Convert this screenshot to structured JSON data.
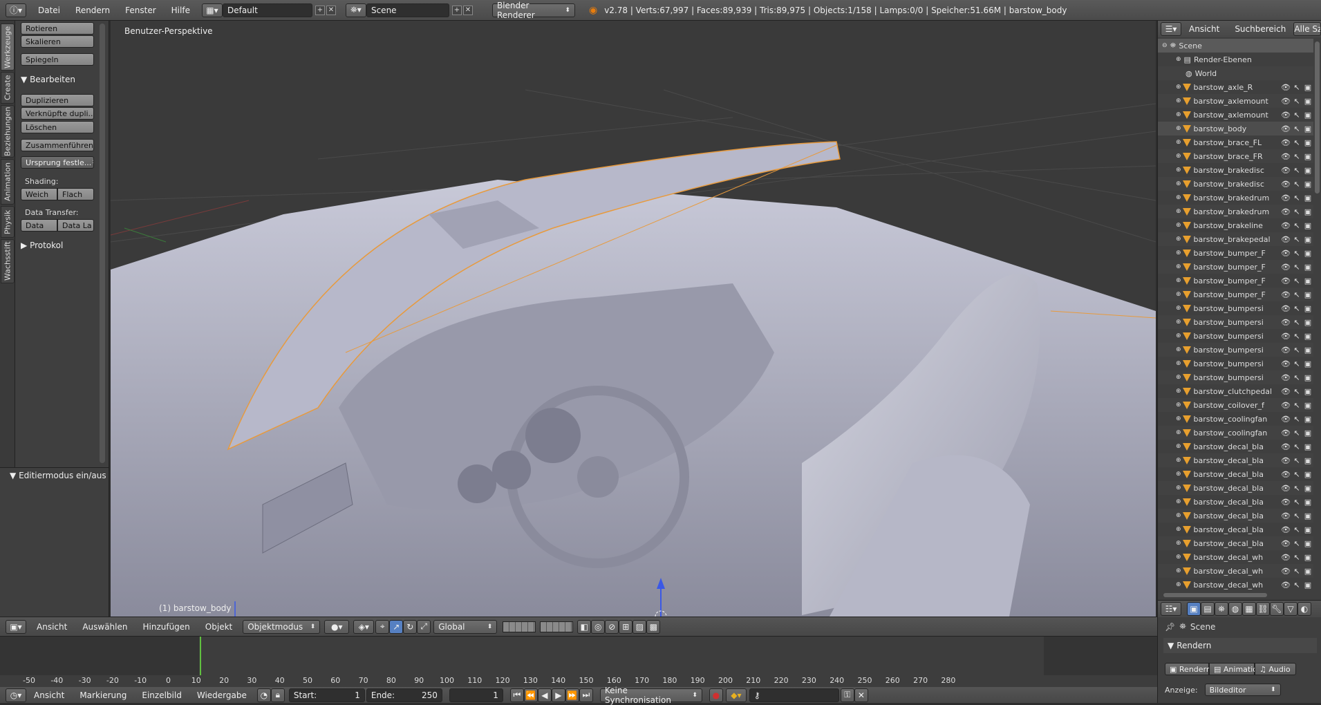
{
  "topbar": {
    "menus": [
      "Datei",
      "Rendern",
      "Fenster",
      "Hilfe"
    ],
    "screen_layout": "Default",
    "scene": "Scene",
    "renderer": "Blender Renderer",
    "stats": "v2.78 | Verts:67,997 | Faces:89,939 | Tris:89,975 | Objects:1/158 | Lamps:0/0 | Speicher:51.66M | barstow_body"
  },
  "left_tabs": [
    "Werkzeuge",
    "Create",
    "Beziehungen",
    "Animation",
    "Physik",
    "Wachsstift"
  ],
  "toolshelf": {
    "transform_buttons": [
      "Rotieren",
      "Skalieren",
      "Spiegeln"
    ],
    "edit_panel_title": "Bearbeiten",
    "edit_buttons": [
      "Duplizieren",
      "Verknüpfte dupli...",
      "Löschen",
      "Zusammenführen",
      "Ursprung festle..."
    ],
    "shading_label": "Shading:",
    "shading_smooth": "Weich",
    "shading_flat": "Flach",
    "data_transfer_label": "Data Transfer:",
    "data_btn": "Data",
    "data_layers_btn": "Data La",
    "history_title": "Protokol",
    "operator_panel_title": "Editiermodus ein/aus"
  },
  "viewport": {
    "view_name": "Benutzer-Perspektive",
    "active_object": "(1) barstow_body"
  },
  "view_header": {
    "menus": [
      "Ansicht",
      "Auswählen",
      "Hinzufügen",
      "Objekt"
    ],
    "mode": "Objektmodus",
    "orientation": "Global"
  },
  "timeline": {
    "ticks": [
      "-50",
      "-40",
      "-30",
      "-20",
      "-10",
      "0",
      "10",
      "20",
      "30",
      "40",
      "50",
      "60",
      "70",
      "80",
      "90",
      "100",
      "110",
      "120",
      "130",
      "140",
      "150",
      "160",
      "170",
      "180",
      "190",
      "200",
      "210",
      "220",
      "230",
      "240",
      "250",
      "260",
      "270",
      "280"
    ],
    "current_frame": 1,
    "menus": [
      "Ansicht",
      "Markierung",
      "Einzelbild",
      "Wiedergabe"
    ],
    "start_label": "Start:",
    "start_value": "1",
    "end_label": "Ende:",
    "end_value": "250",
    "frame_value": "1",
    "sync": "Keine Synchronisation"
  },
  "outliner": {
    "tabs": [
      "Ansicht",
      "Suchbereich",
      "Alle Szenen"
    ],
    "scene": "Scene",
    "render_layers": "Render-Ebenen",
    "world": "World",
    "objects": [
      "barstow_axle_R",
      "barstow_axlemount",
      "barstow_axlemount",
      "barstow_body",
      "barstow_brace_FL",
      "barstow_brace_FR",
      "barstow_brakedisc",
      "barstow_brakedisc",
      "barstow_brakedrum",
      "barstow_brakedrum",
      "barstow_brakeline",
      "barstow_brakepedal",
      "barstow_bumper_F",
      "barstow_bumper_F",
      "barstow_bumper_F",
      "barstow_bumper_F",
      "barstow_bumpersi",
      "barstow_bumpersi",
      "barstow_bumpersi",
      "barstow_bumpersi",
      "barstow_bumpersi",
      "barstow_bumpersi",
      "barstow_clutchpedal",
      "barstow_coilover_f",
      "barstow_coolingfan",
      "barstow_coolingfan",
      "barstow_decal_bla",
      "barstow_decal_bla",
      "barstow_decal_bla",
      "barstow_decal_bla",
      "barstow_decal_bla",
      "barstow_decal_bla",
      "barstow_decal_bla",
      "barstow_decal_bla",
      "barstow_decal_wh",
      "barstow_decal_wh",
      "barstow_decal_wh"
    ]
  },
  "properties": {
    "context": "Scene",
    "panel_title": "Rendern",
    "buttons": [
      "Rendern",
      "Animatio",
      "Audio"
    ],
    "display_label": "Anzeige:",
    "display_value": "Bildeditor"
  },
  "colors": {
    "accent_blue": "#5680c2",
    "mesh_orange": "#e79f2e",
    "selection_outline": "#f0a030"
  }
}
